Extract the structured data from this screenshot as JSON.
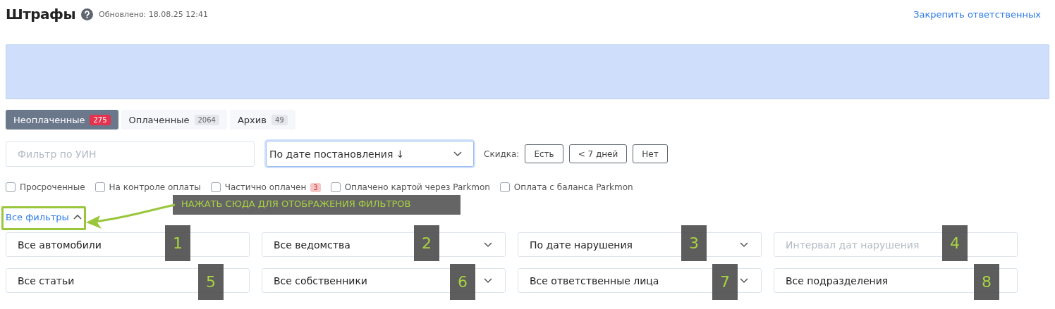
{
  "header": {
    "title": "Штрафы",
    "updated": "Обновлено: 18.08.25 12:41",
    "action_link": "Закрепить ответственных"
  },
  "tabs": [
    {
      "label": "Неоплаченные",
      "count": "275",
      "selected": true
    },
    {
      "label": "Оплаченные",
      "count": "2064",
      "selected": false
    },
    {
      "label": "Архив",
      "count": "49",
      "selected": false
    }
  ],
  "uin_filter": {
    "placeholder": "Фильтр по УИН"
  },
  "sort_select": {
    "value": "По дате постановления ↓",
    "focused": true
  },
  "discount": {
    "label": "Скидка:",
    "buttons": [
      "Есть",
      "< 7 дней",
      "Нет"
    ]
  },
  "checkboxes": [
    {
      "label": "Просроченные",
      "checked": false
    },
    {
      "label": "На контроле оплаты",
      "checked": false
    },
    {
      "label": "Частично оплачен",
      "count": "3",
      "checked": false
    },
    {
      "label": "Оплачено картой через Parkmon",
      "checked": false
    },
    {
      "label": "Оплата с баланса Parkmon",
      "checked": false
    }
  ],
  "all_filters": {
    "label": "Все фильтры",
    "expanded": true
  },
  "filters": [
    {
      "kind": "text",
      "value": "Все автомобили"
    },
    {
      "kind": "dropdown",
      "value": "Все ведомства"
    },
    {
      "kind": "dropdown",
      "value": "По дате нарушения"
    },
    {
      "kind": "text",
      "placeholder": "Интервал дат нарушения"
    },
    {
      "kind": "text",
      "value": "Все статьи"
    },
    {
      "kind": "dropdown",
      "value": "Все собственники"
    },
    {
      "kind": "dropdown",
      "value": "Все ответственные лица"
    },
    {
      "kind": "text",
      "value": "Все подразделения"
    }
  ],
  "annotations": {
    "callout": "НАЖАТЬ СЮДА ДЛЯ ОТОБРАЖЕНИЯ ФИЛЬТРОВ",
    "markers": [
      "1",
      "2",
      "3",
      "4",
      "5",
      "6",
      "7",
      "8"
    ]
  }
}
